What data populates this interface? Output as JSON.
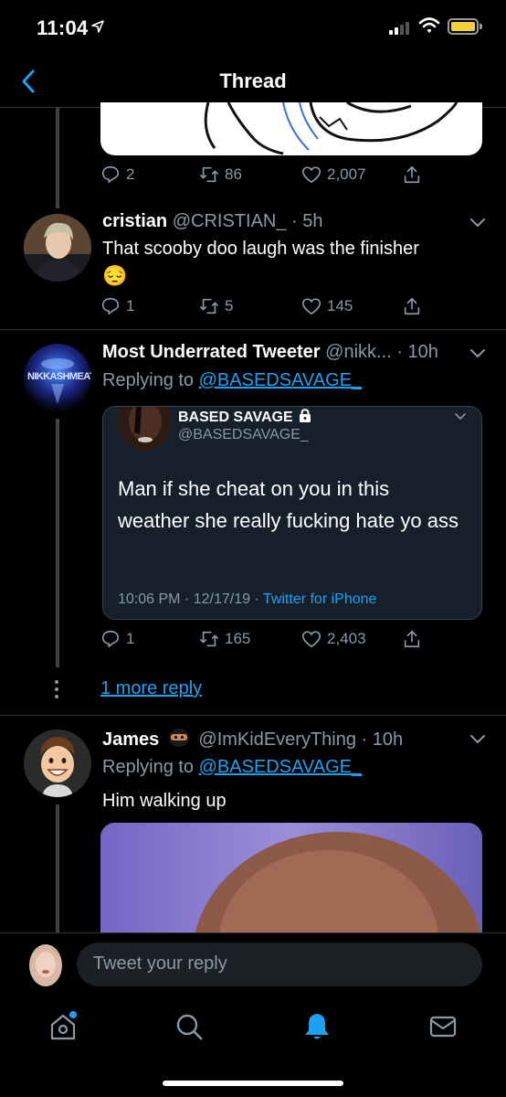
{
  "status_bar": {
    "time": "11:04",
    "location_arrow": "location-arrow-icon",
    "battery_color": "#f4d03f"
  },
  "header": {
    "title": "Thread",
    "back_icon": "chevron-left-icon"
  },
  "colors": {
    "accent": "#1da1f2",
    "muted": "#8899a6",
    "background": "#000000"
  },
  "tweet1_actions": {
    "replies": "2",
    "retweets": "86",
    "likes": "2,007"
  },
  "tweet2": {
    "name": "cristian",
    "handle": "@CRISTIAN_",
    "time": "5h",
    "text": "That scooby doo laugh was the finisher",
    "emoji": "😔",
    "replies": "1",
    "retweets": "5",
    "likes": "145"
  },
  "tweet3": {
    "name": "Most Underrated Tweeter",
    "handle": "@nikk...",
    "time": "10h",
    "avatar_text": "NIKKASHMEAT",
    "replying_prefix": "Replying to ",
    "replying_to": "@BASEDSAVAGE_",
    "quote": {
      "name": "BASED SAVAGE",
      "handle": "@BASEDSAVAGE_",
      "text": "Man if she cheat on you in this weather she really fucking hate yo ass",
      "time": "10:06 PM",
      "date": "12/17/19",
      "source": "Twitter for iPhone"
    },
    "replies": "1",
    "retweets": "165",
    "likes": "2,403"
  },
  "more_replies": "1 more reply",
  "tweet4": {
    "name": "James",
    "handle": "@ImKidEveryThing",
    "time": "10h",
    "replying_prefix": "Replying to ",
    "replying_to": "@BASEDSAVAGE_",
    "text": "Him walking up"
  },
  "composer": {
    "placeholder": "Tweet your reply"
  },
  "tabs": [
    "home-icon",
    "search-icon",
    "notifications-icon",
    "messages-icon"
  ]
}
